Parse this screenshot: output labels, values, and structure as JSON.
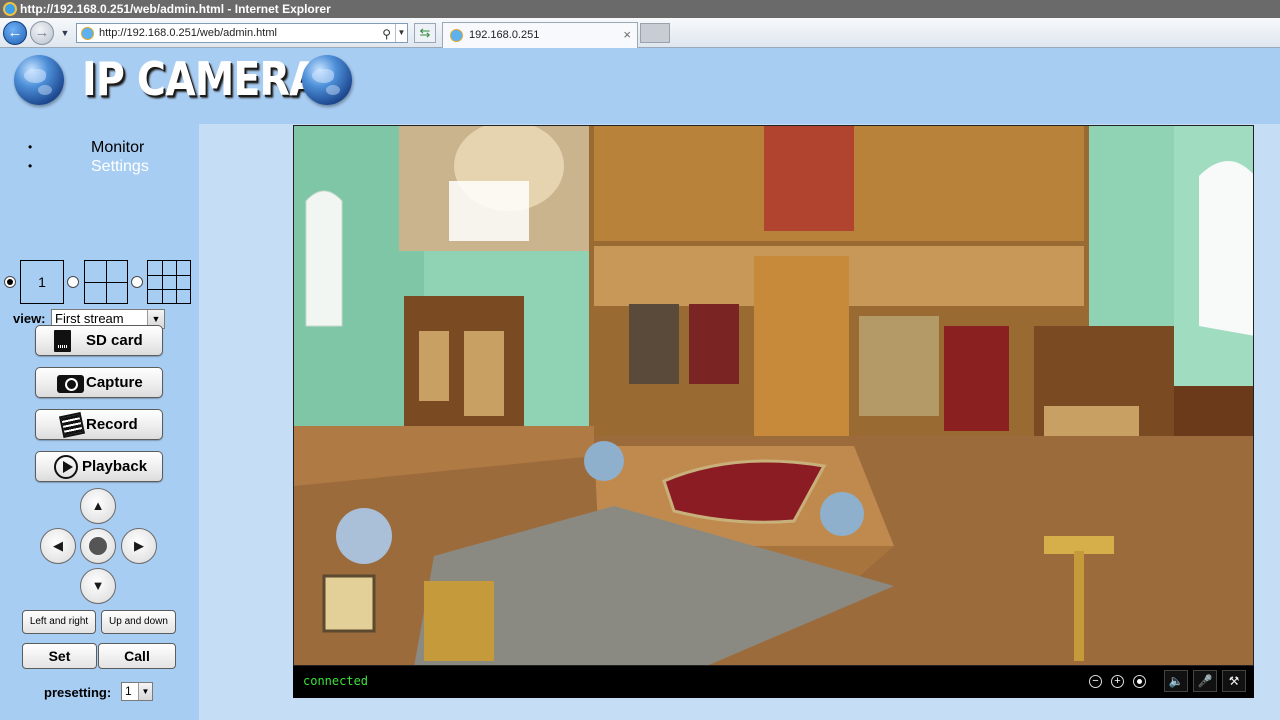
{
  "browser": {
    "window_title": "http://192.168.0.251/web/admin.html - Internet Explorer",
    "address": "http://192.168.0.251/web/admin.html",
    "tab_title": "192.168.0.251"
  },
  "header": {
    "logo_text": "IP CAMERA"
  },
  "sidebar": {
    "menu": [
      {
        "label": "Monitor",
        "color": "#000000"
      },
      {
        "label": "Settings",
        "color": "#ffffff"
      }
    ],
    "layouts": [
      {
        "label": "1",
        "selected": true
      },
      {
        "label": "",
        "selected": false
      },
      {
        "label": "",
        "selected": false
      }
    ],
    "view_label": "view:",
    "view_value": "First stream",
    "buttons": {
      "sdcard": "SD card",
      "capture": "Capture",
      "record": "Record",
      "playback": "Playback"
    },
    "ptz": {
      "up": "▲",
      "left": "◀",
      "right": "▶",
      "down": "▼"
    },
    "left_right": "Left and right",
    "up_down": "Up and down",
    "set": "Set",
    "call": "Call",
    "presetting_label": "presetting:",
    "preset_value": "1"
  },
  "video": {
    "status": "connected",
    "status_color": "#3ce03c",
    "icons": [
      "zoom-out-icon",
      "zoom-in-icon",
      "record-dot-icon",
      "speaker-mute-icon",
      "mic-mute-icon",
      "ptz-tools-icon"
    ]
  },
  "colors": {
    "page_background": "#a8cdf3",
    "wall_green": "#8fd3b4",
    "iconostasis_gold": "#b8823a",
    "floor_wood": "#9c6b3c",
    "carpet_red": "#8b1c24"
  }
}
